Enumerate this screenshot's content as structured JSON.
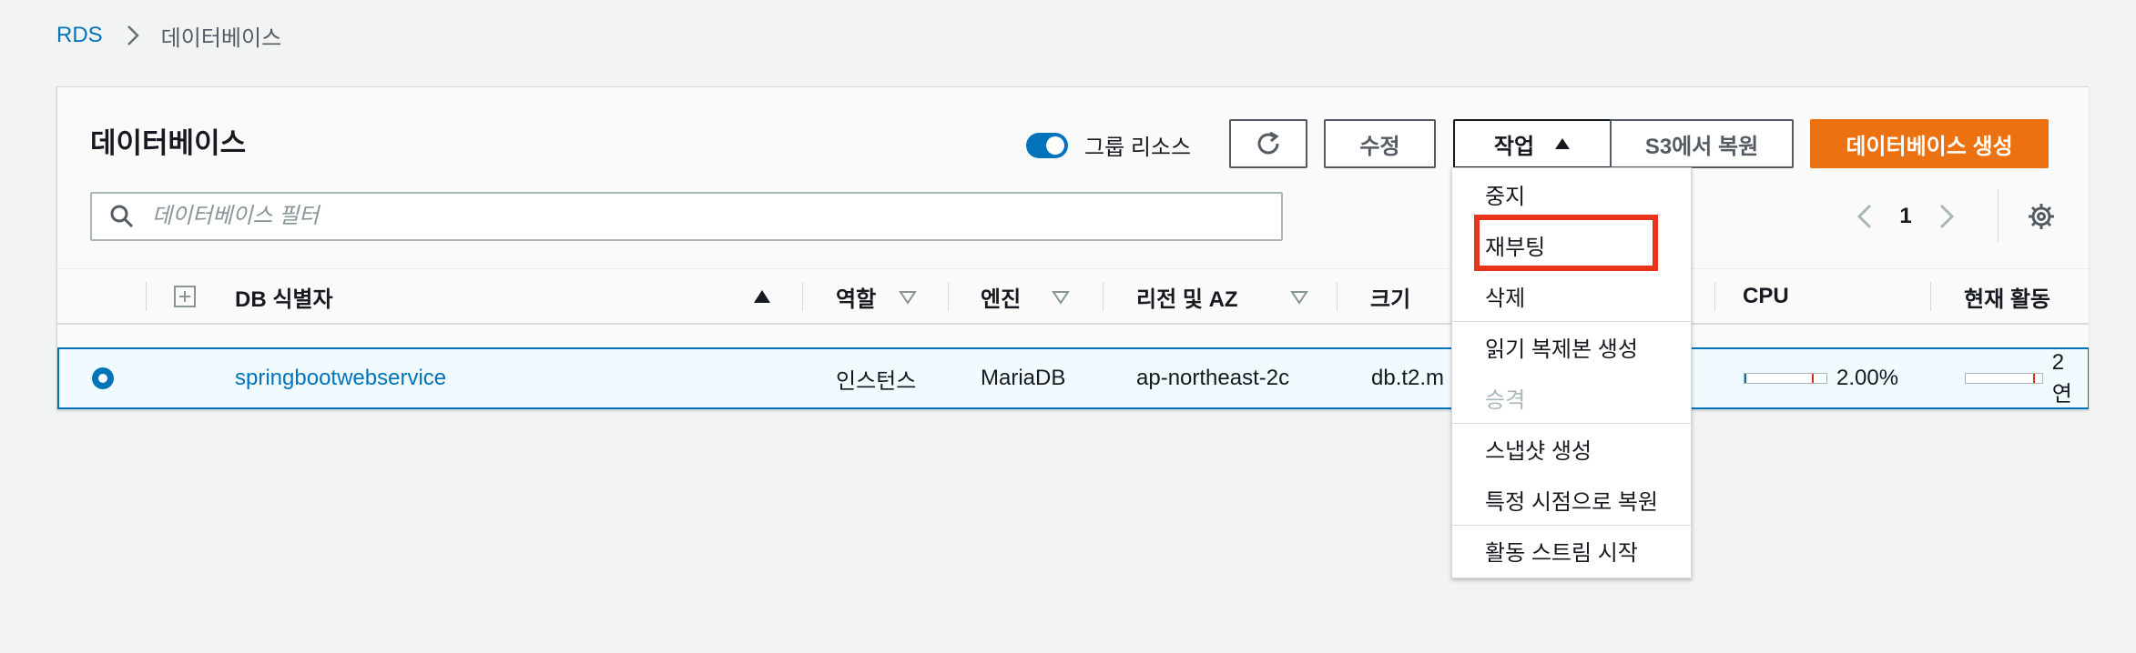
{
  "breadcrumb": {
    "root": "RDS",
    "current": "데이터베이스"
  },
  "panel": {
    "title": "데이터베이스",
    "group_toggle_label": "그룹 리소스",
    "buttons": {
      "edit": "수정",
      "actions": "작업",
      "restore_s3": "S3에서 복원",
      "create": "데이터베이스 생성"
    },
    "search_placeholder": "데이터베이스 필터",
    "pagination": {
      "page": "1"
    }
  },
  "table": {
    "headers": {
      "id": "DB 식별자",
      "role": "역할",
      "engine": "엔진",
      "region": "리전 및 AZ",
      "size": "크기",
      "cpu": "CPU",
      "activity": "현재 활동"
    },
    "rows": [
      {
        "id": "springbootwebservice",
        "role": "인스턴스",
        "engine": "MariaDB",
        "region": "ap-northeast-2c",
        "size": "db.t2.m",
        "cpu": "2.00%",
        "cpu_fraction": 0.02,
        "activity": "2 연"
      }
    ]
  },
  "actions_menu": {
    "items": [
      "중지",
      "재부팅",
      "삭제",
      "읽기 복제본 생성",
      "승격",
      "스냅샷 생성",
      "특정 시점으로 복원",
      "활동 스트림 시작"
    ],
    "disabled": [
      "승격"
    ],
    "highlighted": "재부팅"
  },
  "colors": {
    "accent": "#0073bb",
    "primary_button": "#ec7211",
    "highlight": "#e8341c"
  }
}
